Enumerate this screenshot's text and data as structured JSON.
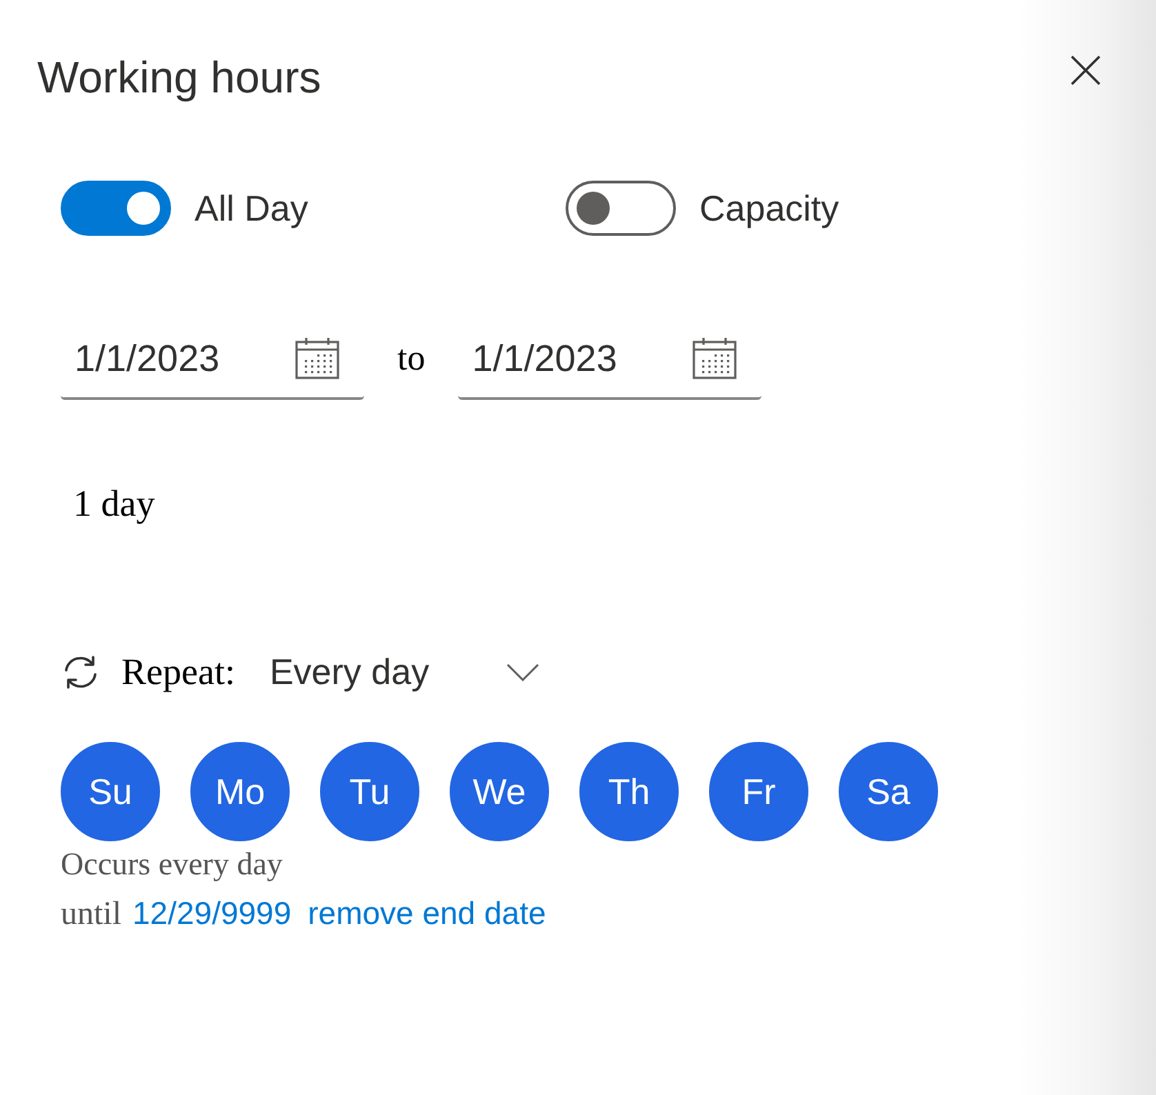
{
  "panel": {
    "title": "Working hours"
  },
  "toggles": [
    {
      "label": "All Day",
      "on": true
    },
    {
      "label": "Capacity",
      "on": false
    }
  ],
  "date_range": {
    "start": {
      "value": "1/1/2023"
    },
    "separator": "to",
    "end": {
      "value": "1/1/2023"
    }
  },
  "duration": "1 day",
  "repeat": {
    "label": "Repeat:",
    "value": "Every day"
  },
  "days": [
    {
      "label": "Su",
      "selected": true
    },
    {
      "label": "Mo",
      "selected": true
    },
    {
      "label": "Tu",
      "selected": true
    },
    {
      "label": "We",
      "selected": true
    },
    {
      "label": "Th",
      "selected": true
    },
    {
      "label": "Fr",
      "selected": true
    },
    {
      "label": "Sa",
      "selected": true
    }
  ],
  "summary": "Occurs every day",
  "end": {
    "prefix": "until",
    "date": "12/29/9999",
    "remove_link": "remove end date"
  }
}
